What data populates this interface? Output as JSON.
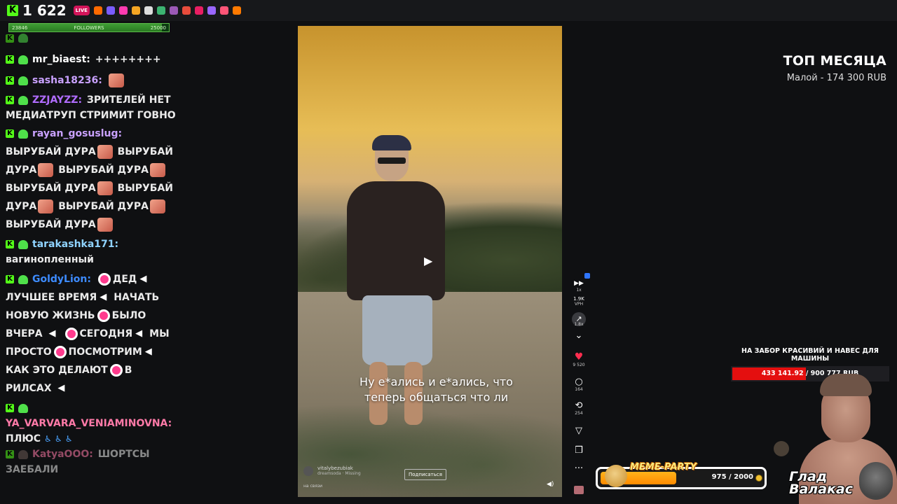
{
  "topbar": {
    "viewers": "1 622",
    "live_badge": "LIVE",
    "kick_letter": "K",
    "extensions": [
      "#ff6a00",
      "#7a5cff",
      "#ff3bb0",
      "#f5a623",
      "#ddd",
      "#3cb371",
      "#9b59b6",
      "#e74c3c",
      "#e91e63",
      "#9966ff",
      "#ff5577",
      "#ff7a00"
    ]
  },
  "followers": {
    "current": "23846",
    "label": "FOLLOWERS",
    "goal": "25000",
    "progress": 0.954
  },
  "chat": {
    "messages": [
      {
        "user": "mr_biaest:",
        "color": "#ffffff",
        "text": "++++++++"
      },
      {
        "user": "sasha18236:",
        "color": "#c9a1ff",
        "text": ""
      },
      {
        "user": "ZZJAYZZ:",
        "color": "#b06cff",
        "text": "ЗРИТЕЛЕЙ НЕТ МЕДИАТРУП СТРИМИТ ГОВНО"
      },
      {
        "user": "rayan_gosuslug:",
        "color": "#c9a1ff",
        "text": "ВЫРУБАЙ ДУРА"
      },
      {
        "user": "tarakashka171:",
        "color": "#8fd3ff",
        "text": "вагинопленный"
      },
      {
        "user": "GoldyLion:",
        "color": "#3d8bff",
        "text": "ДЕД"
      },
      {
        "user": "YA_VARVARA_VENIAMINOVNA:",
        "color": "#ff7aa8",
        "text": "ПЛЮС"
      },
      {
        "user": "KatyaOOO:",
        "color": "#ff7aa8",
        "text": "ШОРТСЫ ЗАЕБАЛИ"
      }
    ],
    "vyrubai": "ВЫРУБАЙ ДУРА",
    "goldy_parts": [
      "ЛУЧШЕЕ ВРЕМЯ",
      "НАЧАТЬ",
      "НОВУЮ ЖИЗНЬ",
      "БЫЛО ВЧЕРА",
      "СЕГОДНЯ",
      "МЫ",
      "ПРОСТО",
      "ПОСМОТРИМ",
      "КАК ЭТО ДЕЛАЮТ",
      "В РИЛСАХ"
    ],
    "plus_icons": "♿ ♿ ♿"
  },
  "video": {
    "caption": "Ну е*ались и е*ались, что теперь общаться что ли",
    "author": "vitalybezubiak",
    "song": "dreamsoda · Missing",
    "network": "на связи",
    "subscribe": "Подписаться",
    "play_icon": "play-icon"
  },
  "controls": {
    "speed": "1x",
    "views": "1.9K",
    "views_unit": "VPH",
    "share_count": "1.8x",
    "likes": "9 520",
    "comments": "164",
    "reposts": "254"
  },
  "top_month": {
    "title": "ТОП МЕСЯЦА",
    "entry": "Малой - 174 300 RUB"
  },
  "goal": {
    "title": "НА ЗАБОР КРАСИВИЙ И НАВЕС ДЛЯ МАШИНЫ",
    "value": "433 141.92 / 900 777 RUB",
    "progress": 0.481
  },
  "meme_party": {
    "title": "MEME-PARTY",
    "value": "975 / 2000",
    "progress": 0.4875
  },
  "streamer_name": "Глад Валакас"
}
